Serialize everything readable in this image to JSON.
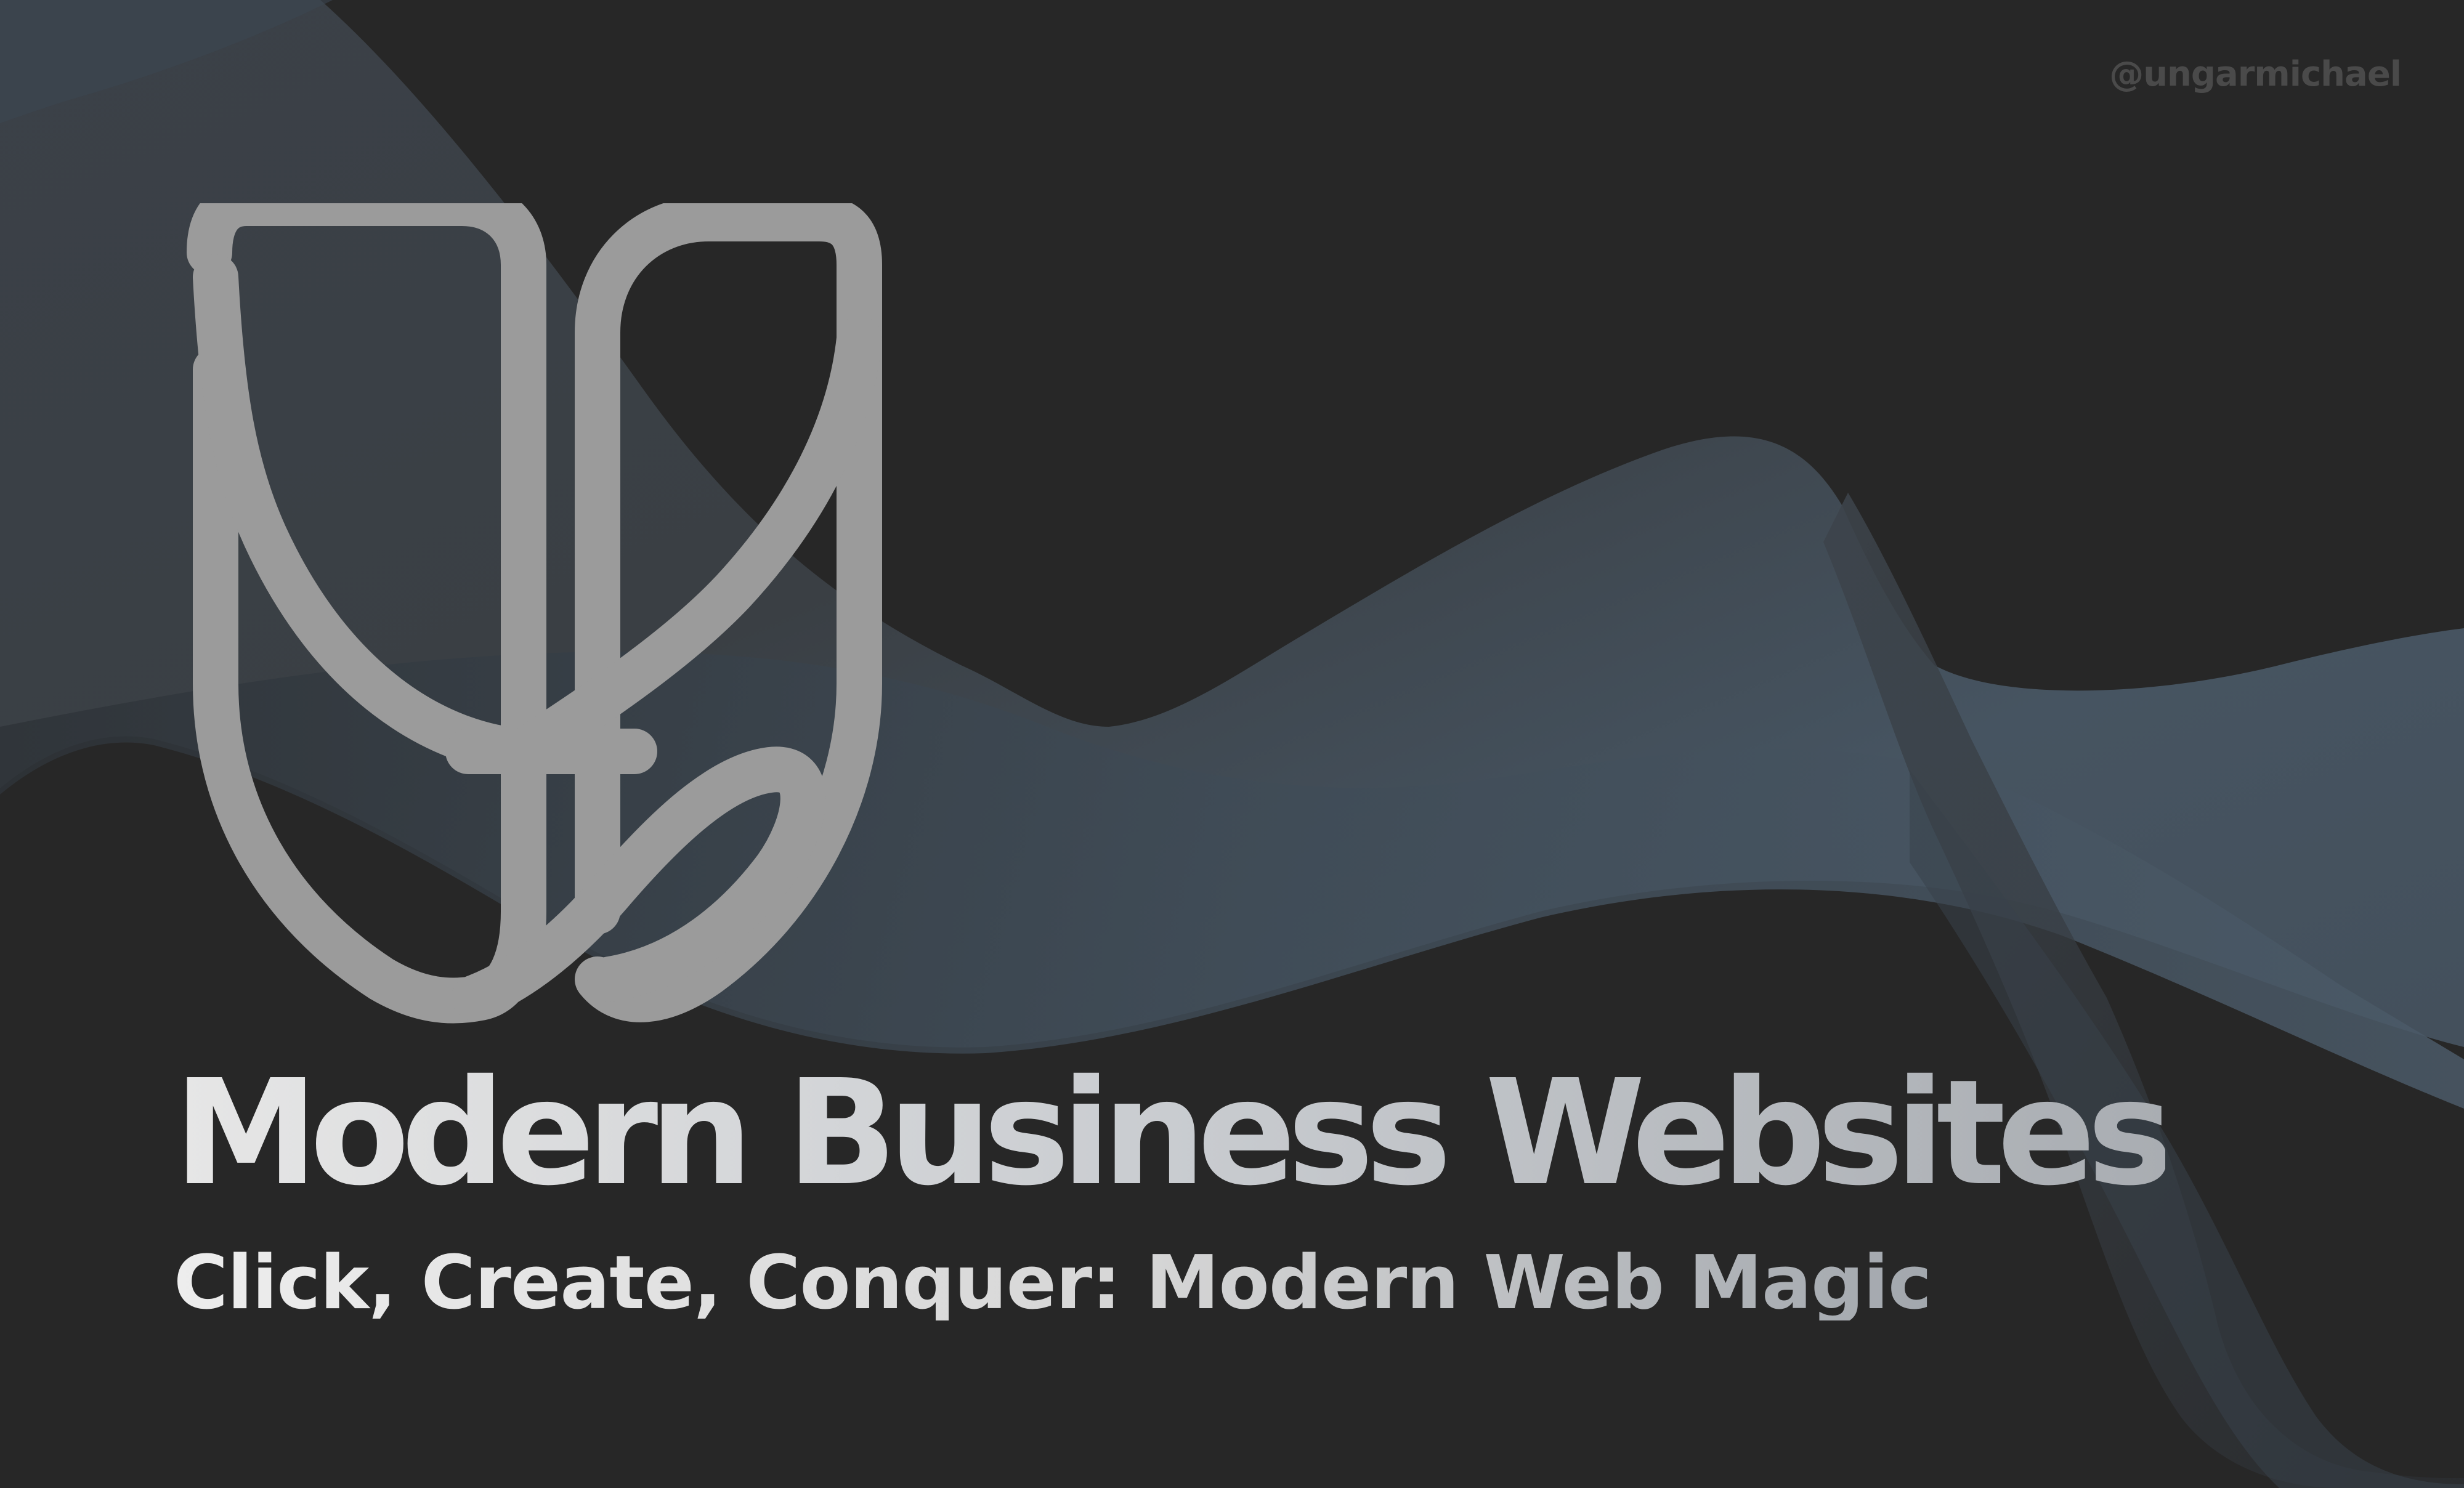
{
  "handle": "@ungarmichael",
  "headline": "Modern Business Websites",
  "subheadline": "Click, Create, Conquer: Modern Web Magic",
  "logo": {
    "icon": "stylized-u-b-monogram-icon",
    "color": "#9b9b9b"
  },
  "background": {
    "base_color": "#272727",
    "wave_colors": [
      "#3a4550",
      "#46525e",
      "#2f3740"
    ]
  },
  "text_colors": {
    "handle": "#4a4a4a",
    "headline_start": "#e6e6e6",
    "headline_end": "#a9adb2"
  }
}
